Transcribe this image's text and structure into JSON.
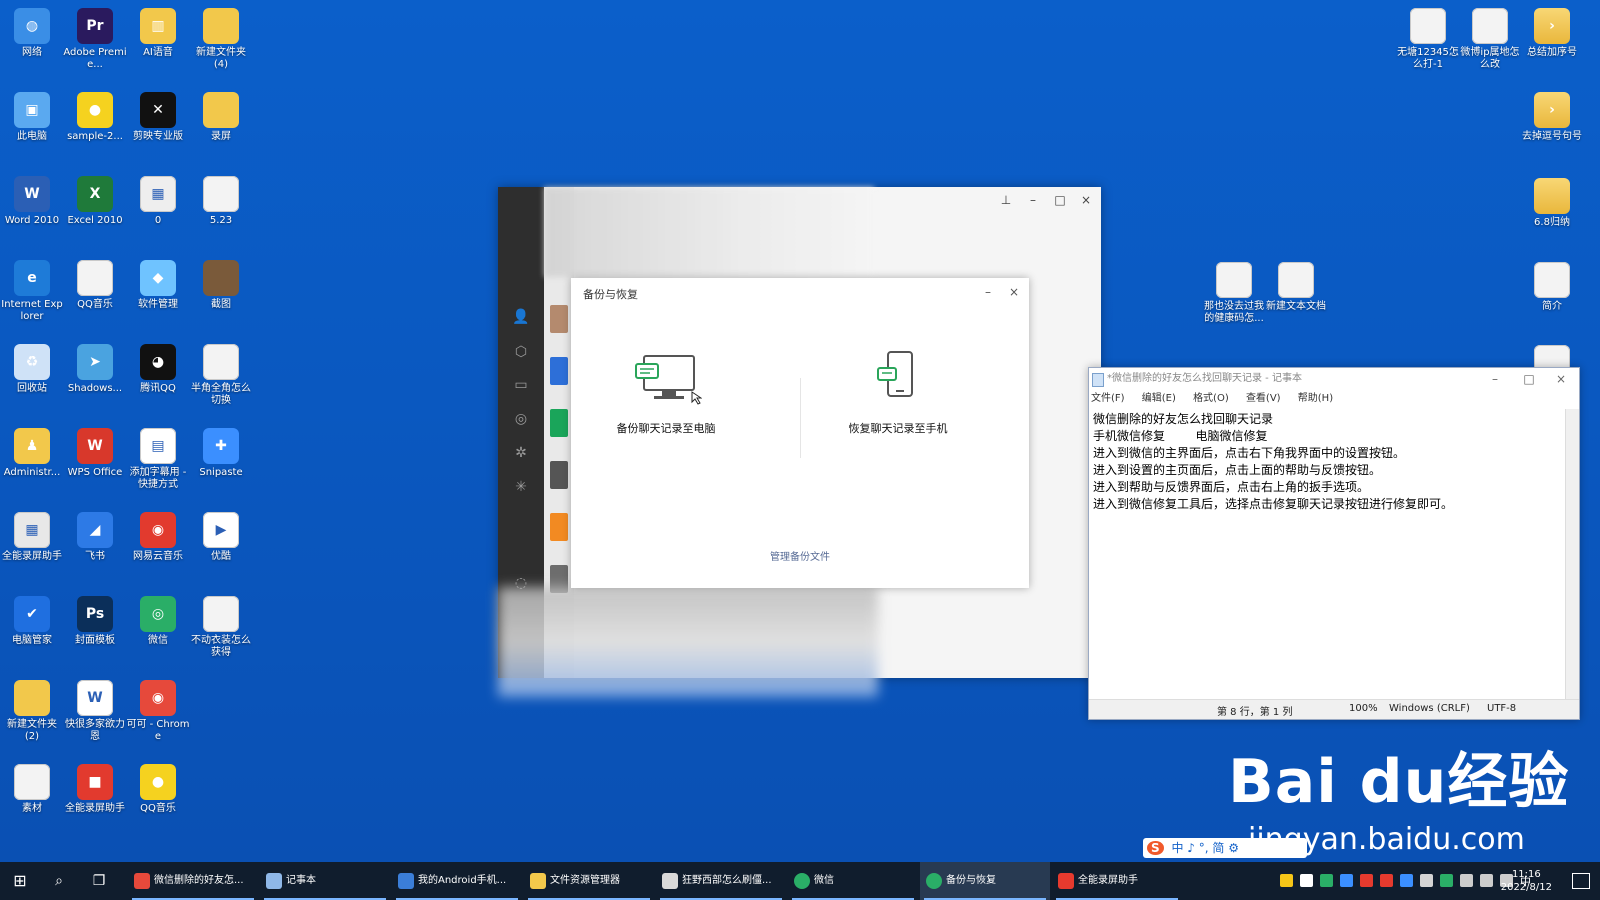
{
  "desktop": {
    "left_icons": [
      [
        "网络",
        "Adobe Premie...",
        "AI语音",
        "新建文件夹 (4)"
      ],
      [
        "此电脑",
        "sample-2...",
        "剪映专业版",
        "录屏"
      ],
      [
        "Word 2010",
        "Excel 2010",
        "0",
        "5.23"
      ],
      [
        "Internet Explorer",
        "QQ音乐",
        "软件管理",
        "截图"
      ],
      [
        "回收站",
        "Shadows...",
        "腾讯QQ",
        "半角全角怎么切换"
      ],
      [
        "Administr...",
        "WPS Office",
        "添加字幕用 - 快捷方式",
        "Snipaste"
      ],
      [
        "全能录屏助手",
        "飞书",
        "网易云音乐",
        "优酷"
      ],
      [
        "电脑管家",
        "封面模板",
        "微信",
        "不动衣装怎么获得"
      ],
      [
        "新建文件夹 (2)",
        "快很多家欲力恩",
        "可可 - Chrome",
        ""
      ],
      [
        "素材",
        "全能录屏助手",
        "QQ音乐",
        ""
      ]
    ],
    "right_icons": {
      "r1": [
        "无塘12345怎么打-1",
        "微博ip属地怎么改",
        "总结加序号"
      ],
      "r2": "去掉逗号句号",
      "r3": "6.8归纳",
      "mid": [
        "那也没去过我的健康码怎...",
        "新建文本文档"
      ],
      "r4": "简介"
    }
  },
  "wechat": {
    "window_controls": {
      "pin": "⊥",
      "min": "–",
      "max": "□",
      "close": "×"
    }
  },
  "backup_dialog": {
    "title": "备份与恢复",
    "min": "–",
    "close": "×",
    "option_left": "备份聊天记录至电脑",
    "option_right": "恢复聊天记录至手机",
    "manage_link": "管理备份文件"
  },
  "notepad": {
    "title": "*微信删除的好友怎么找回聊天记录 - 记事本",
    "menu": [
      "文件(F)",
      "编辑(E)",
      "格式(O)",
      "查看(V)",
      "帮助(H)"
    ],
    "lines": [
      "微信删除的好友怎么找回聊天记录",
      "手机微信修复        电脑微信修复",
      "进入到微信的主界面后，点击右下角我界面中的设置按钮。",
      "进入到设置的主页面后，点击上面的帮助与反馈按钮。",
      "进入到帮助与反馈界面后，点击右上角的扳手选项。",
      "进入到微信修复工具后，选择点击修复聊天记录按钮进行修复即可。"
    ],
    "status": {
      "pos": "第 8 行，第 1 列",
      "zoom": "100%",
      "eol": "Windows (CRLF)",
      "enc": "UTF-8"
    }
  },
  "watermark": {
    "brand": "Bai du经验",
    "url": "jingyan.baidu.com"
  },
  "ime": {
    "logo": "S",
    "text": "中 ♪ °, 简 ⚙"
  },
  "taskbar": {
    "items": [
      "微信删除的好友怎...",
      "记事本",
      "我的Android手机...",
      "文件资源管理器",
      "狂野西部怎么刷僵...",
      "微信",
      "备份与恢复",
      "全能录屏助手"
    ],
    "tray_lang": "中",
    "time": "11:16",
    "date": "2022/8/12"
  },
  "colors": {
    "accent_arrow": "#ee5a2a",
    "link": "#576b95",
    "desktop": "#0a5bc4"
  }
}
